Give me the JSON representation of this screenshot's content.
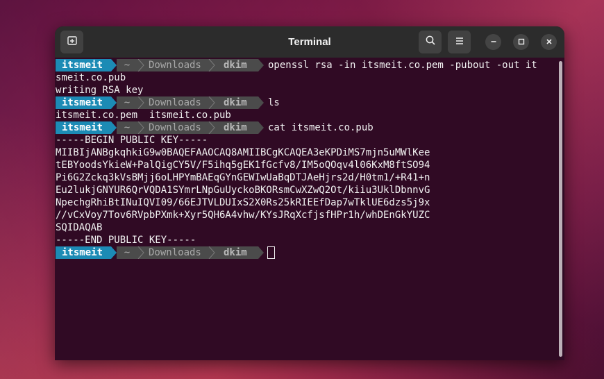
{
  "window": {
    "title": "Terminal"
  },
  "prompt": {
    "user": "itsmeit",
    "home": "~",
    "dir": "Downloads",
    "branch": "dkim"
  },
  "lines": {
    "l1": "openssl rsa -in itsmeit.co.pem -pubout -out it",
    "l2": "smeit.co.pub",
    "l3": "writing RSA key",
    "l4": "ls",
    "l5": "itsmeit.co.pem  itsmeit.co.pub",
    "l6": "cat itsmeit.co.pub",
    "l7": "-----BEGIN PUBLIC KEY-----",
    "l8": "MIIBIjANBgkqhkiG9w0BAQEFAAOCAQ8AMIIBCgKCAQEA3eKPDiMS7mjn5uMWlKee",
    "l9": "tEBYoodsYkieW+PalQigCY5V/F5ihq5gEK1fGcfv8/IM5oQOqv4l06KxM8ftSO94",
    "l10": "Pi6G2Zckq3kVsBMjj6oLHPYmBAEqGYnGEWIwUaBqDTJAeHjrs2d/H0tm1/+R41+n",
    "l11": "Eu2lukjGNYUR6QrVQDA1SYmrLNpGuUyckoBKORsmCwXZwQ2Ot/kiiu3UklDbnnvG",
    "l12": "NpechgRhiBtINuIQVI09/66EJTVLDUIxS2X0Rs25kRIEEfDap7wTklUE6dzs5j9x",
    "l13": "//vCxVoy7Tov6RVpbPXmk+Xyr5QH6A4vhw/KYsJRqXcfjsfHPr1h/whDEnGkYUZC",
    "l14": "SQIDAQAB",
    "l15": "-----END PUBLIC KEY-----"
  },
  "icons": {
    "new_tab": "new-tab-icon",
    "search": "search-icon",
    "menu": "hamburger-menu-icon",
    "minimize": "minimize-icon",
    "maximize": "maximize-icon",
    "close": "close-icon"
  },
  "colors": {
    "terminal_bg": "#300a24",
    "titlebar_bg": "#2c2c2c",
    "prompt_user_bg": "#1c8bb5",
    "prompt_segment_bg": "#4b4b4b"
  }
}
